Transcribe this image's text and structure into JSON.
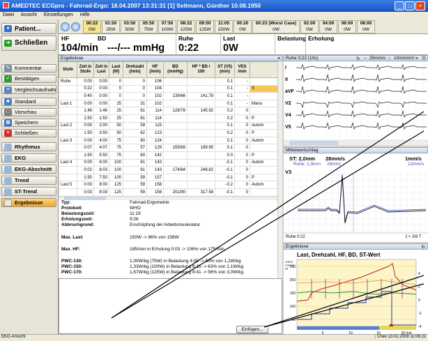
{
  "window": {
    "title": "AMEDTEC ECGpro  -  Fahrrad-Ergo: 18.04.2007 13:31:31   [1] Seltmann, Günther 10.08.1950"
  },
  "menu": [
    "Datei",
    "Ansicht",
    "Einstellungen",
    "Hilfe"
  ],
  "nav": {
    "patient": "Patient...",
    "close_main": "Schließen",
    "items": [
      "Kommentar",
      "Bestätigen",
      "Vergleichsaufnahm.",
      "Standard",
      "Vorschau",
      "Speichern",
      "Schließen",
      "Rhythmus",
      "EKG",
      "EKG-Abschnitt",
      "Trend",
      "ST-Trend",
      "Ergebnisse"
    ]
  },
  "steps": [
    {
      "time": "00:22",
      "load": "0W"
    },
    {
      "time": "01:50",
      "load": "25W"
    },
    {
      "time": "03:50",
      "load": "50W"
    },
    {
      "time": "05:50",
      "load": "75W"
    },
    {
      "time": "07:50",
      "load": "100W"
    },
    {
      "time": "08:22",
      "load": "125W"
    },
    {
      "time": "09:50",
      "load": "125W"
    },
    {
      "time": "11:05",
      "load": "150W"
    },
    {
      "time": "00:20",
      "load": "0W"
    },
    {
      "time": "00:23 (Worst Case)",
      "load": "0W"
    },
    {
      "time": "02:00",
      "load": "0W"
    },
    {
      "time": "04:00",
      "load": "0W"
    },
    {
      "time": "06:00",
      "load": "0W"
    },
    {
      "time": "08:00",
      "load": "0W"
    }
  ],
  "vitals": {
    "hf_label": "HF",
    "bd_label": "BD",
    "hf_value": "104/min",
    "bd_value": "---/--- mmHg",
    "ruhe_label": "Ruhe",
    "ruhe_value": "0:22",
    "last_label": "Last",
    "last_value": "0W",
    "belastung_label": "Belastung",
    "erholung_label": "Erholung"
  },
  "results": {
    "title": "Ergebnisse",
    "columns": [
      "Stufe",
      "Zeit in Stufe",
      "Zeit in Last",
      "Last (W)",
      "Drehzahl (/min)",
      "HF (/min)",
      "BD (mmHg)",
      "HF * BD / 100",
      "ST (V5) (mm)",
      "VES /min",
      ""
    ],
    "rows": [
      [
        "Ruhe",
        "0:00",
        "0:00",
        "0",
        "0",
        "106",
        "",
        "",
        "0.1",
        "-",
        ""
      ],
      [
        "",
        "0:22",
        "0:00",
        "0",
        "0",
        "104",
        "",
        "",
        "0.1",
        "-",
        "S"
      ],
      [
        "",
        "0:40",
        "0:00",
        "0",
        "0",
        "102",
        "139/66",
        "141.78",
        "0.1",
        "-",
        ""
      ],
      [
        "Last 1",
        "0:00",
        "0:00",
        "25",
        "31",
        "102",
        "",
        "",
        "0.1",
        "-",
        "Manu"
      ],
      [
        "",
        "1:46",
        "1:46",
        "25",
        "61",
        "114",
        "128/78",
        "145.92",
        "0.2",
        "0",
        ""
      ],
      [
        "",
        "1:50",
        "1:50",
        "25",
        "61",
        "114",
        "",
        "",
        "0.2",
        "0",
        "P"
      ],
      [
        "Last 2",
        "0:00",
        "2:00",
        "50",
        "59",
        "115",
        "",
        "",
        "0.1",
        "0",
        "Autom"
      ],
      [
        "",
        "1:50",
        "3:50",
        "50",
        "62",
        "123",
        "",
        "",
        "0.2",
        "0",
        "P"
      ],
      [
        "Last 3",
        "0:00",
        "4:00",
        "75",
        "60",
        "124",
        "",
        "",
        "0.1",
        "0",
        "Autom"
      ],
      [
        "",
        "0:07",
        "4:07",
        "75",
        "57",
        "129",
        "155/69",
        "199.95",
        "0.1",
        "0",
        ""
      ],
      [
        "",
        "1:50",
        "5:50",
        "75",
        "60",
        "142",
        "",
        "",
        "0.0",
        "0",
        "P"
      ],
      [
        "Last 4",
        "0:00",
        "6:00",
        "100",
        "61",
        "143",
        "",
        "",
        "-0.1",
        "0",
        "Autom"
      ],
      [
        "",
        "0:02",
        "6:03",
        "100",
        "61",
        "143",
        "174/84",
        "248.82",
        "-0.1",
        "0",
        ""
      ],
      [
        "",
        "1:50",
        "7:50",
        "100",
        "59",
        "157",
        "",
        "",
        "-0.1",
        "0",
        "P"
      ],
      [
        "Last 5",
        "0:00",
        "8:00",
        "125",
        "59",
        "158",
        "",
        "",
        "-0.2",
        "0",
        "Autom"
      ],
      [
        "",
        "0:03",
        "8:03",
        "125",
        "59",
        "158",
        "201/90",
        "317.58",
        "-0.1",
        "0",
        ""
      ]
    ]
  },
  "summary": [
    {
      "key": "Typ:",
      "value": "Fahrrad-Ergometrie"
    },
    {
      "key": "Protokoll:",
      "value": "WHO"
    },
    {
      "key": "Belastungszeit:",
      "value": "11:19"
    },
    {
      "key": "Erholungszeit:",
      "value": "9:26"
    },
    {
      "key": "Abbruchgrund:",
      "value": "Erschöpfung der Arbeitsmuskulatur"
    },
    {
      "key": "Max. Last:",
      "value": "150W -> 96% von 156W"
    },
    {
      "key": "Max. HF:",
      "value": "185/min in Erholung 0:03 -> 106% von 175/min"
    },
    {
      "key": "PWC-130:",
      "value": "1,00W/kg (75W) in Belastung 4:05 -> 83% von 1,2W/kg"
    },
    {
      "key": "PWC-150:",
      "value": "1,33W/kg (100W) in Belastung 6:15 -> 63% von 2,1W/kg"
    },
    {
      "key": "PWC-170:",
      "value": "1,67W/kg (125W) in Belastung 8:41 -> 56% von 3,0W/kg"
    }
  ],
  "insert_button": "Einfügen...",
  "ekg": {
    "title": "Ruhe 0:22 (10s)",
    "speed": "25mm/s",
    "gain": "10mm/mV",
    "leads": [
      "I",
      "II",
      "aVF",
      "V2",
      "V4",
      "V5"
    ]
  },
  "mittelwert": {
    "title": "Mittelwertschlag",
    "st_label": "ST: 2,0mm",
    "speed1": "28mm/s",
    "ruhe_label": "Ruhe: 1,9mm",
    "speed2": "28mm/",
    "right_top": "1mm/s",
    "right_sub": "12mm/s",
    "lead": "V3",
    "footer_left": "Ruhe 0:22",
    "footer_right": "J + 2/8 T"
  },
  "graph": {
    "panel_title": "Ergebnisse",
    "title": "Last, Drehzahl, HF, BD, ST-Wert",
    "y_unit": "1/min\nmmHg\nW",
    "y_ticks": [
      "250",
      "200",
      "150",
      "100",
      "50"
    ],
    "right_ticks": [
      "4",
      "2",
      "0",
      "-2",
      "-4"
    ],
    "x_ticks": [
      "5",
      "10",
      "15",
      "20 min"
    ]
  },
  "status": {
    "left": "EKG-Ansicht",
    "right": "Chex 13.02.2008 11:06:21"
  },
  "colors": {
    "title_bar": "#1650c8",
    "selected": "#f2a62c",
    "red_marker": "#e01818",
    "step_highlight": "#f6e58a"
  }
}
